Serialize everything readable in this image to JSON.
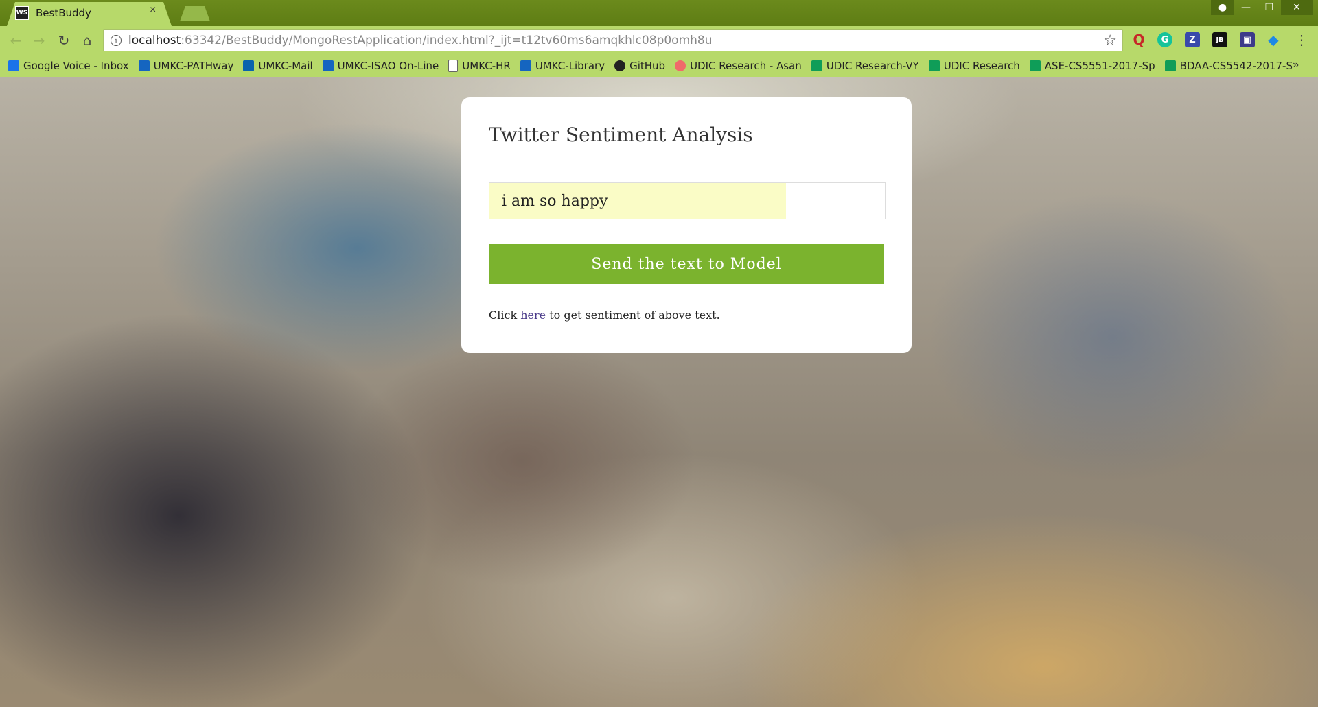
{
  "browser": {
    "tab_title": "BestBuddy",
    "tab_close": "×",
    "favicon_text": "WS",
    "url_host": "localhost",
    "url_rest": ":63342/BestBuddy/MongoRestApplication/index.html?_ijt=t12tv60ms6amqkhlc08p0omh8u",
    "bookmarks": [
      {
        "label": "Google Voice - Inbox",
        "color": "#1a73e8"
      },
      {
        "label": "UMKC-PATHway",
        "color": "#1565c0"
      },
      {
        "label": "UMKC-Mail",
        "color": "#0a64ad"
      },
      {
        "label": "UMKC-ISAO On-Line",
        "color": "#1565c0"
      },
      {
        "label": "UMKC-HR",
        "color": "#ffffff"
      },
      {
        "label": "UMKC-Library",
        "color": "#1565c0"
      },
      {
        "label": "GitHub",
        "color": "#222222"
      },
      {
        "label": "UDIC Research - Asan",
        "color": "#f06a6a"
      },
      {
        "label": "UDIC Research-VY",
        "color": "#0f9d58"
      },
      {
        "label": "UDIC Research",
        "color": "#0f9d58"
      },
      {
        "label": "ASE-CS5551-2017-Sp",
        "color": "#0f9d58"
      },
      {
        "label": "BDAA-CS5542-2017-S",
        "color": "#0f9d58"
      }
    ],
    "bookmarks_more": "»"
  },
  "page": {
    "title": "Twitter Sentiment Analysis",
    "input_value": "i am so happy",
    "send_label": "Send the text to Model",
    "hint_prefix": "Click ",
    "hint_link": "here",
    "hint_suffix": " to get sentiment of above text."
  },
  "colors": {
    "accent": "#7bb32e",
    "chrome": "#b7d96a",
    "link": "#4a3a8a"
  }
}
